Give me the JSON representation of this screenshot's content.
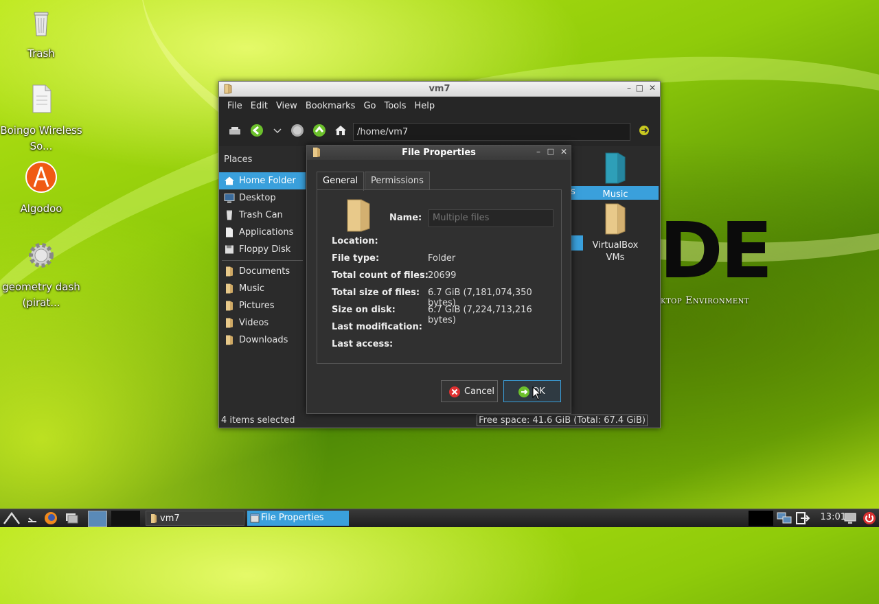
{
  "desktop": {
    "icons": [
      {
        "label": "Trash"
      },
      {
        "label": "Boingo Wireless So..."
      },
      {
        "label": "Algodoo"
      },
      {
        "label": "geometry dash (pirat..."
      }
    ],
    "logo_text": "DE",
    "logo_subtitle": "ktop Environment"
  },
  "file_manager": {
    "title": "vm7",
    "menu": [
      "File",
      "Edit",
      "View",
      "Bookmarks",
      "Go",
      "Tools",
      "Help"
    ],
    "path": "/home/vm7",
    "places_header": "Places",
    "places": [
      {
        "label": "Home Folder",
        "selected": true
      },
      {
        "label": "Desktop"
      },
      {
        "label": "Trash Can"
      },
      {
        "label": "Applications"
      },
      {
        "label": "Floppy Disk"
      }
    ],
    "bookmarks": [
      "Documents",
      "Music",
      "Pictures",
      "Videos",
      "Downloads"
    ],
    "content_items": [
      {
        "label": "Music",
        "partial_label": "s"
      },
      {
        "label": "VirtualBox VMs"
      }
    ],
    "status_left": "4 items selected",
    "status_right": "Free space: 41.6 GiB (Total: 67.4 GiB)"
  },
  "dialog": {
    "title": "File Properties",
    "tabs": [
      "General",
      "Permissions"
    ],
    "active_tab": "General",
    "name_label": "Name:",
    "name_placeholder": "Multiple files",
    "fields": [
      {
        "label": "Location:",
        "value": ""
      },
      {
        "label": "File type:",
        "value": "Folder"
      },
      {
        "label": "Total count of files:",
        "value": "20699"
      },
      {
        "label": "Total size of files:",
        "value": "6.7 GiB (7,181,074,350 bytes)"
      },
      {
        "label": "Size on disk:",
        "value": "6.7 GiB (7,224,713,216 bytes)"
      },
      {
        "label": "Last modification:",
        "value": ""
      },
      {
        "label": "Last access:",
        "value": ""
      }
    ],
    "cancel_label": "Cancel",
    "ok_label": "OK"
  },
  "taskbar": {
    "tasks": [
      "vm7",
      "File Properties"
    ],
    "clock": "13:01"
  },
  "colors": {
    "accent": "#3aa0dc",
    "window_bg": "#2b2b2b"
  }
}
